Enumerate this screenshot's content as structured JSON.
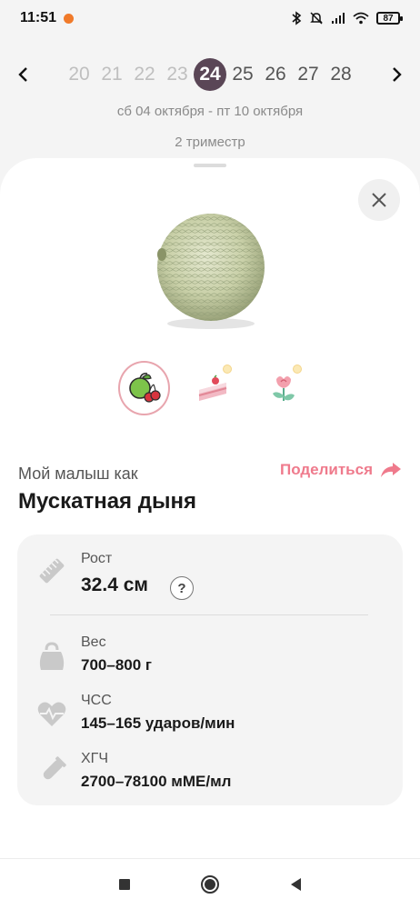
{
  "status": {
    "time": "11:51",
    "battery": "87"
  },
  "week": {
    "numbers": [
      "20",
      "21",
      "22",
      "23",
      "24",
      "25",
      "26",
      "27",
      "28"
    ],
    "active": "24",
    "date_range": "сб 04 октября - пт 10 октября",
    "trimester": "2 триместр"
  },
  "baby": {
    "caption": "Мой малыш как",
    "share_label": "Поделиться",
    "fruit_name": "Мускатная дыня"
  },
  "categories": [
    "fruit-icon",
    "cake-icon",
    "flower-icon"
  ],
  "stats": {
    "height_label": "Рост",
    "height_value": "32.4 см",
    "help": "?",
    "weight_label": "Вес",
    "weight_value": "700–800 г",
    "hr_label": "ЧСС",
    "hr_value": "145–165 ударов/мин",
    "hcg_label": "ХГЧ",
    "hcg_value": "2700–78100 мМЕ/мл"
  },
  "colors": {
    "accent": "#ef7a8c",
    "active_week": "#5a4656",
    "card_bg": "#f4f4f4"
  }
}
